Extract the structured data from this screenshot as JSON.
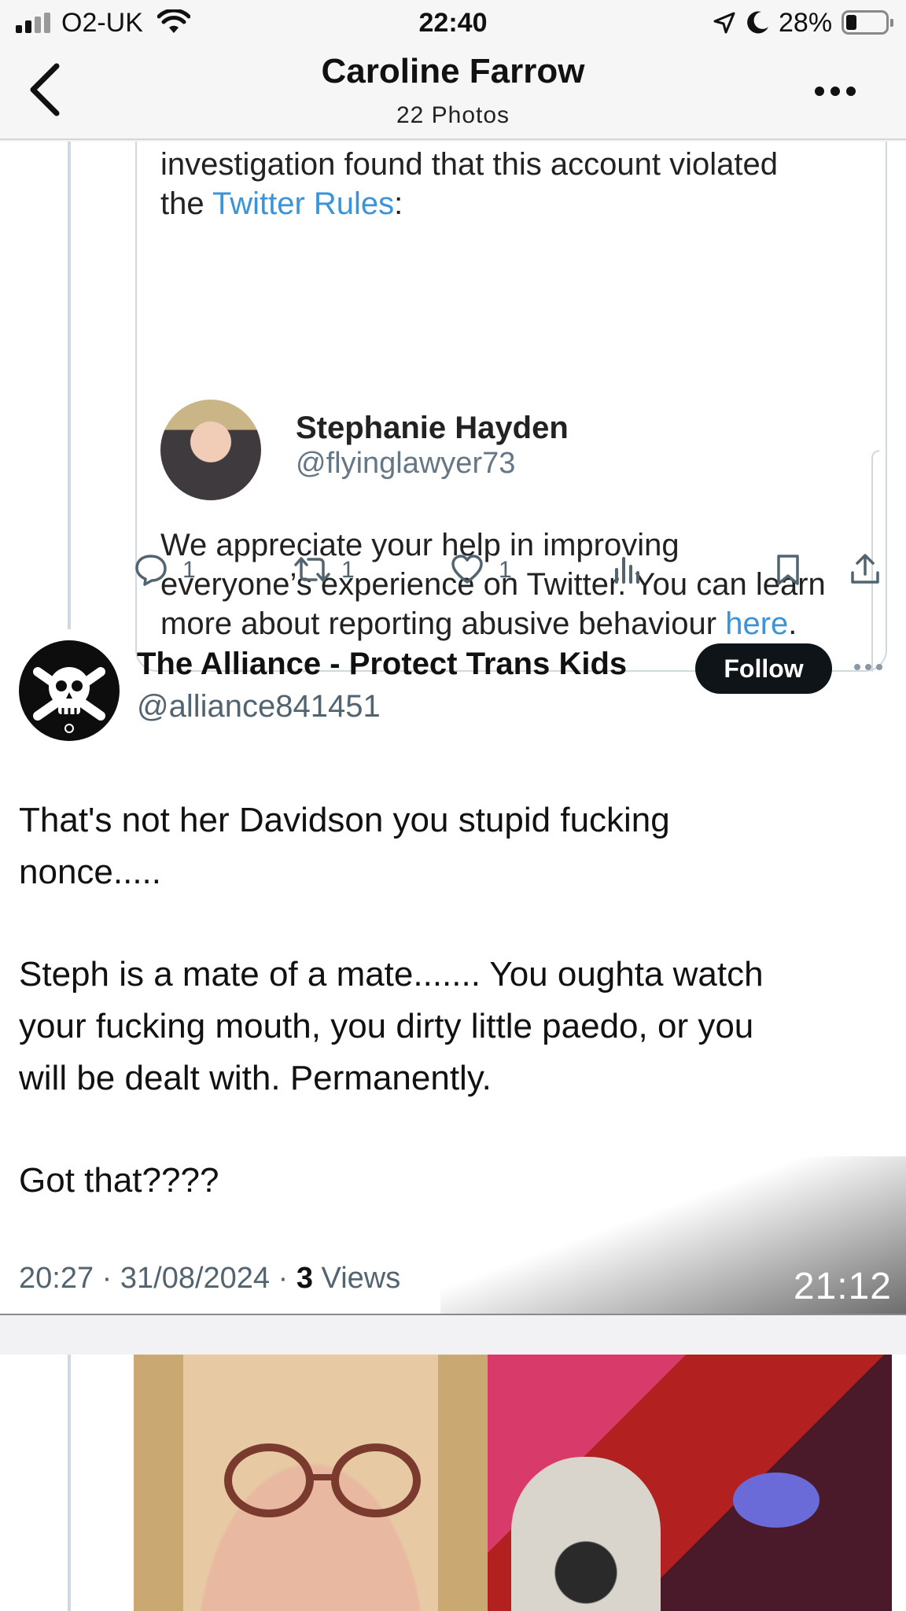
{
  "status_bar": {
    "carrier": "O2-UK",
    "time": "22:40",
    "battery_percent": "28%",
    "battery_level": 0.28,
    "icons": [
      "signal-icon",
      "wifi-icon",
      "location-arrow-icon",
      "moon-icon",
      "battery-icon"
    ]
  },
  "nav": {
    "title": "Caroline Farrow",
    "subtitle": "22 Photos",
    "back_icon": "chevron-left-icon",
    "more_icon": "ellipsis-icon"
  },
  "photo": {
    "quote_card": {
      "line1": "investigation found that this account violated",
      "line2_prefix": "the ",
      "rules_link": "Twitter Rules",
      "line2_suffix": ":",
      "reported_name": "Stephanie Hayden",
      "reported_handle": "@flyinglawyer73",
      "body_line1": "We appreciate your help in improving",
      "body_line2": "everyone’s experience on Twitter. You can learn",
      "body_line3_prefix": "more about reporting abusive behaviour ",
      "body_link": "here",
      "body_line3_suffix": "."
    },
    "actions": {
      "replies": "1",
      "reposts": "1",
      "likes": "1"
    },
    "tweet": {
      "author_name": "The Alliance - Protect Trans Kids",
      "author_handle": "@alliance841451",
      "follow_label": "Follow",
      "body_lines": [
        "That's not her Davidson you stupid fucking",
        "nonce.....",
        "Steph is a mate of a mate.......  You oughta watch",
        "your fucking mouth, you dirty little paedo, or you",
        "will be dealt with.  Permanently.",
        "Got that????"
      ],
      "time": "20:27",
      "date": "31/08/2024",
      "views_count": "3",
      "views_label": "Views",
      "separator": "·"
    },
    "screenshot_timestamp": "21:12"
  }
}
